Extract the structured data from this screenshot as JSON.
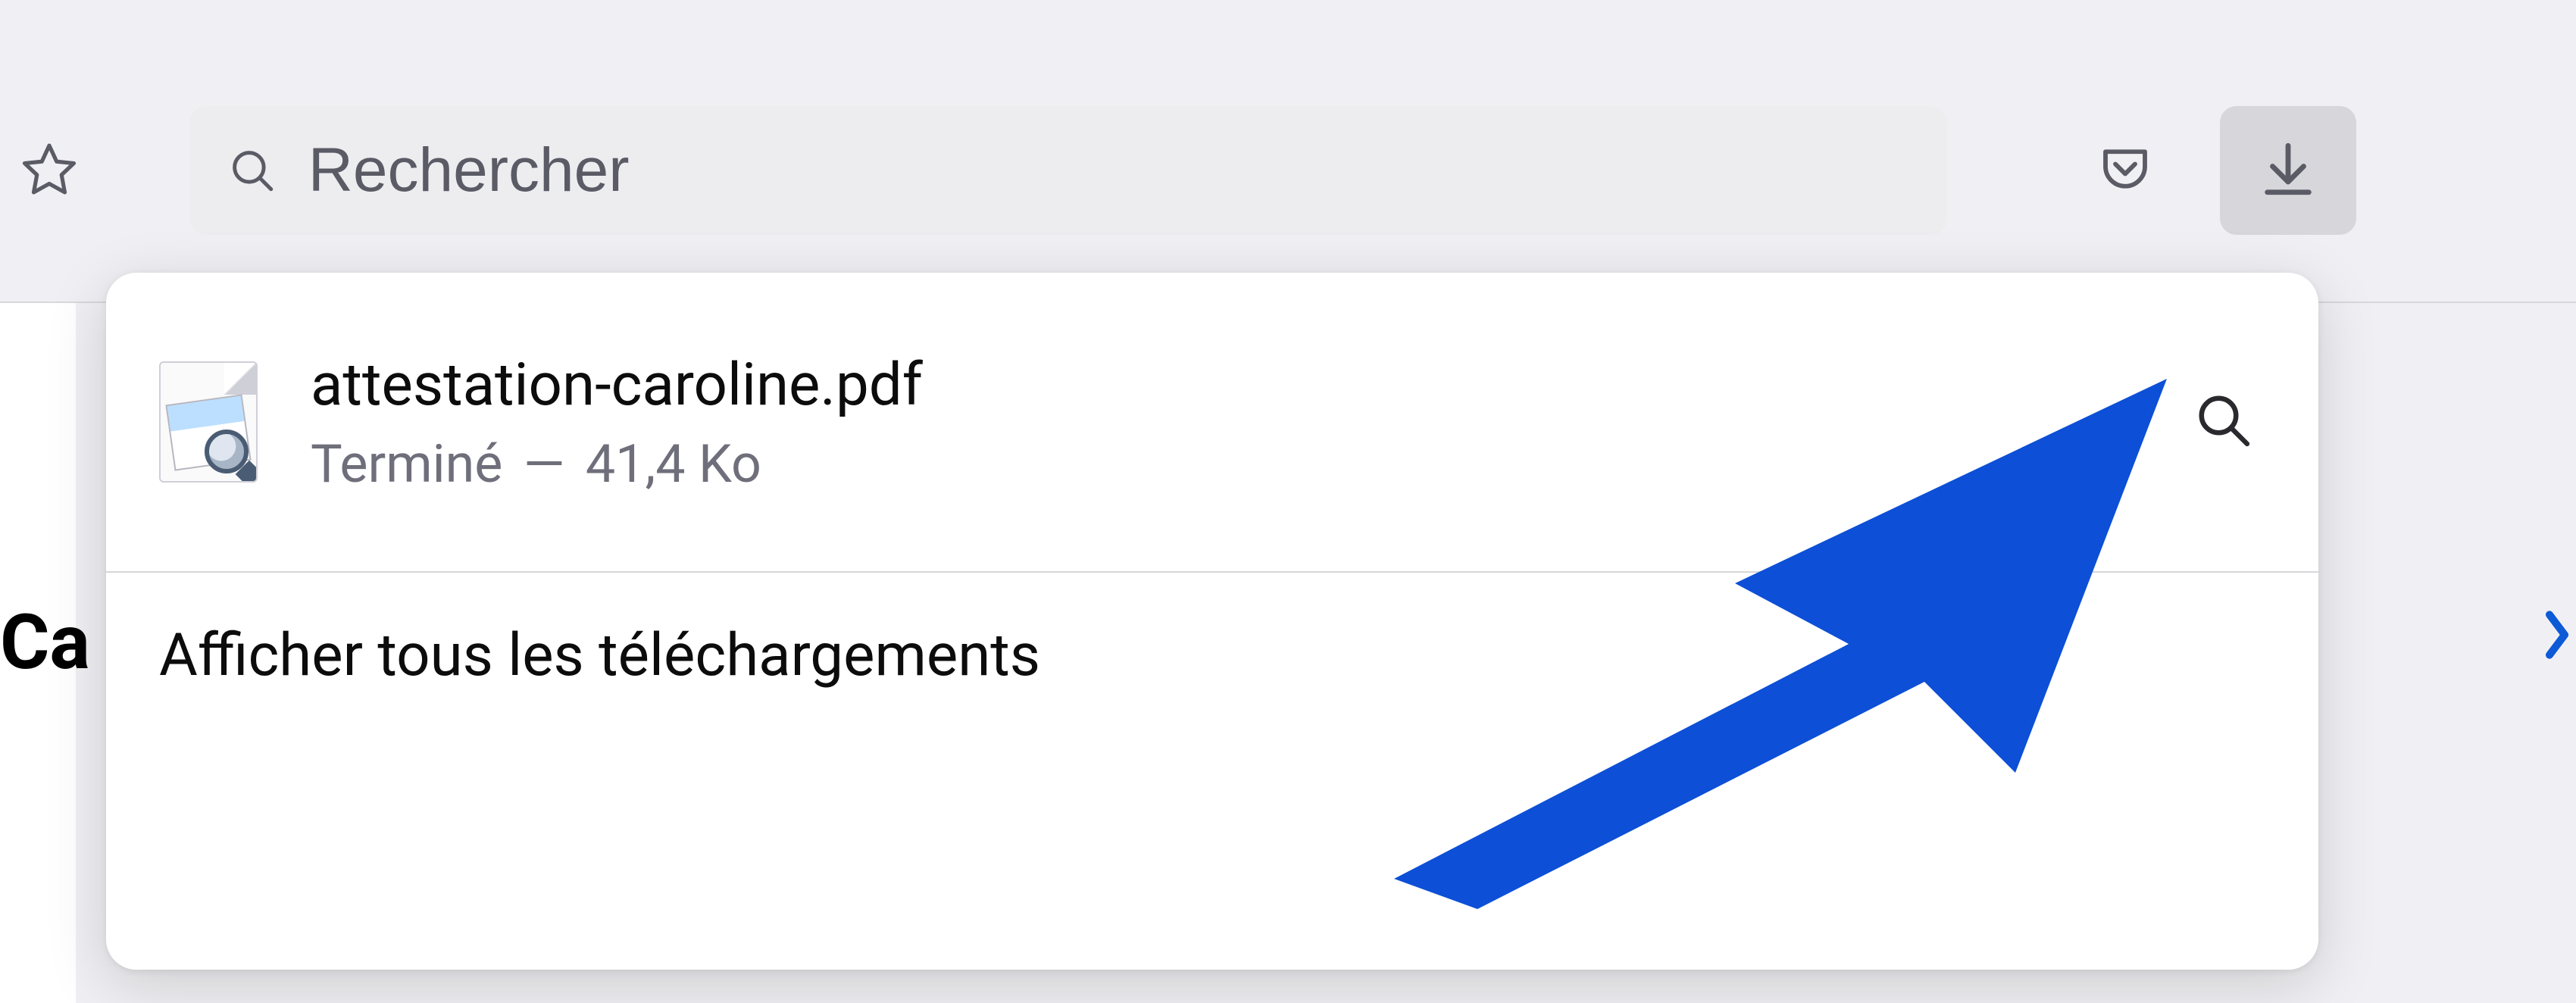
{
  "toolbar": {
    "search": {
      "placeholder": "Rechercher"
    },
    "icons": {
      "bookmark": "star-icon",
      "pocket": "pocket-icon",
      "downloads": "download-icon"
    }
  },
  "page": {
    "heading_partial": "Ca",
    "more_icon": "chevron-right-icon"
  },
  "downloads_panel": {
    "items": [
      {
        "filename": "attestation-caroline.pdf",
        "status": "Terminé",
        "separator": "—",
        "size": "41,4 Ko",
        "thumb_icon": "preview-file-icon",
        "action_icon": "magnifier-icon"
      }
    ],
    "footer_label": "Afficher tous les téléchargements"
  },
  "overlay": {
    "arrow_icon": "cursor-arrow-icon",
    "color": "#0d4fd6"
  }
}
